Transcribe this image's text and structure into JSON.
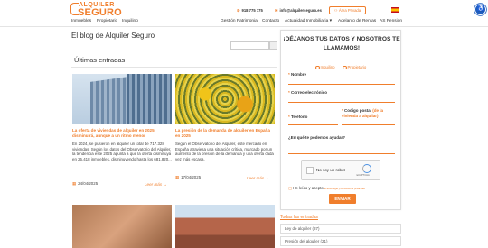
{
  "header": {
    "logo_top": "ALQUILER",
    "logo_bottom": "SEGURO",
    "phone": "918 775 775",
    "email": "info@alquilerseguro.es",
    "private_area": "Área Privada",
    "nav_left": [
      "Inmuebles",
      "Propietario",
      "Inquilino"
    ],
    "nav_right": [
      "Gestión Patrimonial",
      "Contacto",
      "Actualidad Inmobiliaria ▾",
      "Adelanto de Rentas",
      "AS Pensión"
    ]
  },
  "blog": {
    "title": "El blog de Alquiler Seguro",
    "section_title": "Últimas entradas"
  },
  "posts": [
    {
      "title": "La oferta de viviendas de alquiler en 2025 disminuirá, aunque a un ritmo menor",
      "text": "En 2024, se pusieron en alquiler un total de 717.328 viviendas. Según los datos del Observatorio del Alquiler, la tendencia este 2025 apunta a que la oferta disminuya en 25.418 inmuebles, disminuyendo hasta los 681.820...",
      "date": "24/04/2025",
      "read_more": "Leer más →"
    },
    {
      "title": "La presión de la demanda de alquiler en España en 2025",
      "text": "Según el Observatorio del Alquiler, este mercado en España atraviesa una situación crítica, marcado por un aumento de la presión de la demanda y una oferta cada vez más escasa.",
      "date": "17/04/2025",
      "read_more": "Leer más →"
    }
  ],
  "form": {
    "title": "¡DÉJANOS TUS DATOS Y NOSOTROS TE LLAMAMOS!",
    "radio_1": "Inquilino",
    "radio_2": "Propietario",
    "name_label": "Nombre",
    "email_label": "Correo electrónico",
    "phone_label": "Teléfono",
    "postal_label": "Codigo postal",
    "postal_hint": "(de la vivienda a alquilar)",
    "help_label": "¿En qué te podemos ayudar?",
    "captcha_text": "No soy un robot",
    "captcha_brand": "reCAPTCHA",
    "accept_text": "He leído y acepto",
    "accept_link": "el aviso legal y la política de privacidad",
    "submit": "ENVIAR"
  },
  "sidebar": {
    "all_entries": "Todas las entradas",
    "categories": [
      "Ley de alquiler (87)",
      "Presión del alquiler (21)"
    ]
  },
  "colors": {
    "accent": "#f07e2c",
    "accessibility": "#1f5ebf"
  }
}
